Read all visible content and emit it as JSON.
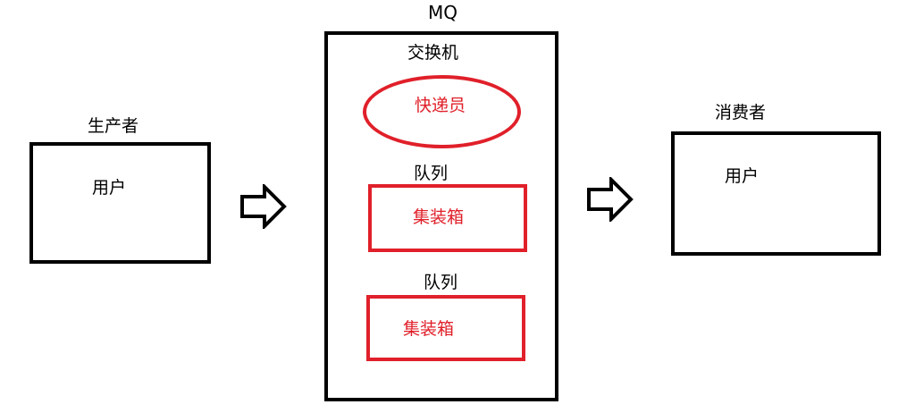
{
  "producer": {
    "title": "生产者",
    "box_label": "用户"
  },
  "mq": {
    "title": "MQ",
    "exchange_title": "交换机",
    "exchange_label": "快递员",
    "queues": [
      {
        "title": "队列",
        "label": "集装箱"
      },
      {
        "title": "队列",
        "label": "集装箱"
      }
    ]
  },
  "consumer": {
    "title": "消费者",
    "box_label": "用户"
  },
  "colors": {
    "outline": "#000000",
    "accent": "#e0202a"
  },
  "icons": [
    "arrow-right-icon",
    "arrow-right-icon"
  ]
}
